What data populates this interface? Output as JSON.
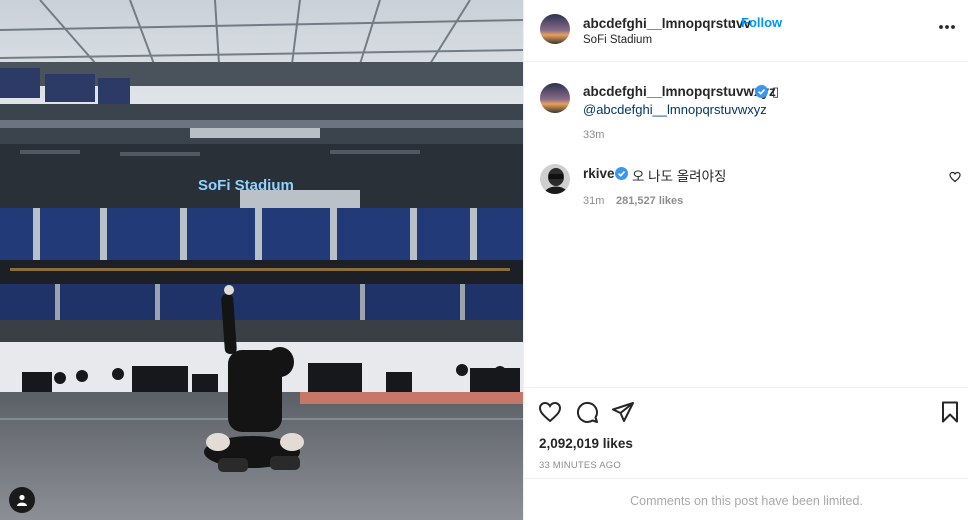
{
  "post": {
    "username": "abcdefghi__lmnopqrstuvv",
    "dot": "•",
    "follow_label": "Follow",
    "location": "SoFi Stadium",
    "more_icon": "more-horizontal-icon"
  },
  "photo": {
    "stadium_sign": "SoFi Stadium",
    "user_tag_icon": "user-tag-icon"
  },
  "caption": {
    "username": "abcdefghi__lmnopqrstuvwxyz",
    "emoji": "▯",
    "mention": "@abcdefghi__lmnopqrstuvwxyz",
    "time": "33m"
  },
  "comment": {
    "username": "rkive",
    "text": "오 나도 올려야징",
    "time": "31m",
    "likes": "281,527 likes"
  },
  "actions": {
    "likes": "2,092,019 likes",
    "posted": "33 MINUTES AGO",
    "comments_limited": "Comments on this post have been limited."
  },
  "colors": {
    "accent": "#0095f6",
    "verified": "#3897f0",
    "muted": "#8e8e8e",
    "link": "#00376b"
  }
}
